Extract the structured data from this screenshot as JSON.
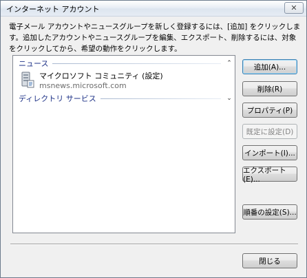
{
  "window": {
    "title": "インターネット アカウント",
    "close_glyph": "✕"
  },
  "description": "電子メール アカウントやニュースグループを新しく登録するには、[追加] をクリックします。追加したアカウントやニュースグループを編集、エクスポート、削除するには、対象をクリックしてから、希望の動作をクリックします。",
  "list": {
    "groups": [
      {
        "label": "ニュース",
        "chevron": "⌃"
      },
      {
        "label": "ディレクトリ サービス",
        "chevron": "⌄"
      }
    ],
    "accounts": [
      {
        "name": "マイクロソフト コミュニティ (設定)",
        "server": "msnews.microsoft.com",
        "icon": "news-server-icon"
      }
    ]
  },
  "buttons": {
    "add": "追加(A)...",
    "remove": "削除(R)",
    "properties": "プロパティ(P)",
    "set_default": "既定に設定(D)",
    "import": "インポート(I)...",
    "export": "エクスポート(E)...",
    "order": "順番の設定(S)...",
    "close": "閉じる"
  },
  "colors": {
    "group_header": "#1e3287",
    "accent_border": "#3c7fb1"
  }
}
